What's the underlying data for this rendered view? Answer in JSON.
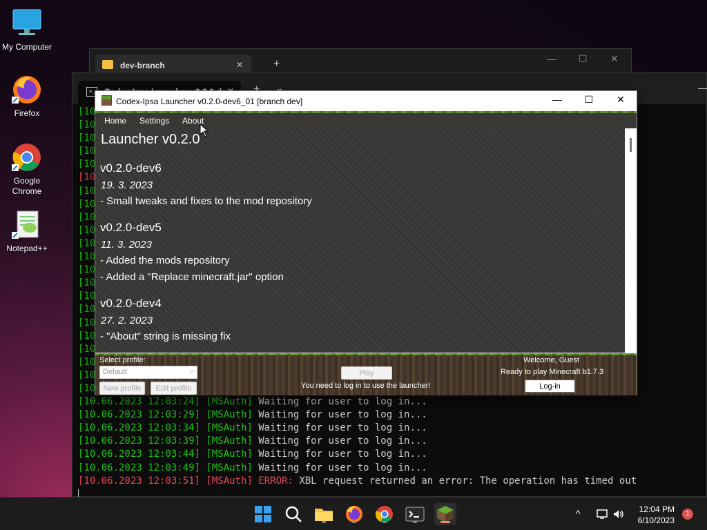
{
  "desktop": {
    "icons": [
      {
        "label1": "My Computer",
        "label2": ""
      },
      {
        "label1": "Firefox",
        "label2": ""
      },
      {
        "label1": "Google",
        "label2": "Chrome"
      },
      {
        "label1": "Notepad++",
        "label2": ""
      }
    ]
  },
  "explorer": {
    "tab_label": "dev-branch",
    "close": "✕",
    "new_tab": "+",
    "minimize": "—",
    "maximize": "☐",
    "close_window": "✕"
  },
  "terminal": {
    "tab_label": "Codex-Ipsa Launcher v0.2.0-d",
    "close": "✕",
    "new_tab": "+",
    "dropdown": "⌄",
    "minimize": "—",
    "hidden_prefixes": [
      "[10",
      "[10",
      "[10",
      "[10",
      "[10",
      "[10",
      "[10",
      "[10",
      "[10",
      "[10",
      "[10",
      "[10",
      "[10",
      "[10",
      "[10",
      "[10",
      "[10",
      "[10",
      "[10",
      "[10",
      "[10",
      "[10"
    ],
    "lines": [
      {
        "ts": "[10.06.2023 12:03:24]",
        "tag": " [MSAuth]",
        "msg": " Waiting for user to log in..."
      },
      {
        "ts": "[10.06.2023 12:03:29]",
        "tag": " [MSAuth]",
        "msg": " Waiting for user to log in..."
      },
      {
        "ts": "[10.06.2023 12:03:34]",
        "tag": " [MSAuth]",
        "msg": " Waiting for user to log in..."
      },
      {
        "ts": "[10.06.2023 12:03:39]",
        "tag": " [MSAuth]",
        "msg": " Waiting for user to log in..."
      },
      {
        "ts": "[10.06.2023 12:03:44]",
        "tag": " [MSAuth]",
        "msg": " Waiting for user to log in..."
      },
      {
        "ts": "[10.06.2023 12:03:49]",
        "tag": " [MSAuth]",
        "msg": " Waiting for user to log in..."
      }
    ],
    "error_line": {
      "ts": "[10.06.2023 12:03:51]",
      "tag": " [MSAuth]",
      "label": " ERROR:",
      "msg": " XBL request returned an error: The operation has timed out"
    }
  },
  "launcher": {
    "title": "Codex-Ipsa Launcher v0.2.0-dev6_01 [branch dev]",
    "controls": {
      "minimize": "—",
      "maximize": "☐",
      "close": "✕"
    },
    "menu": [
      "Home",
      "Settings",
      "About"
    ],
    "heading": "Launcher v0.2.0",
    "changelog": [
      {
        "version": "v0.2.0-dev6",
        "date": "19. 3. 2023",
        "items": [
          "- Small tweaks and fixes to the mod repository"
        ]
      },
      {
        "version": "v0.2.0-dev5",
        "date": "11. 3. 2023",
        "items": [
          "- Added the mods repository",
          "- Added a \"Replace minecraft.jar\" option"
        ]
      },
      {
        "version": "v0.2.0-dev4",
        "date": "27. 2. 2023",
        "items": [
          "- \"About\" string is missing fix"
        ]
      }
    ],
    "bottom": {
      "select_profile_label": "Select profile:",
      "profile_value": "Default",
      "new_profile": "New profile",
      "edit_profile": "Edit profile",
      "play": "Play",
      "login_notice": "You need to log in to use the launcher!",
      "welcome": "Welcome, Guest",
      "ready": "Ready to play Minecraft b1.7.3",
      "login_button": "Log-in"
    }
  },
  "taskbar": {
    "icons": [
      "start-icon",
      "search-icon",
      "file-explorer-icon",
      "firefox-icon",
      "chrome-icon",
      "terminal-icon",
      "minecraft-launcher-icon"
    ],
    "time": "12:04 PM",
    "date": "6/10/2023",
    "notifications": "1",
    "tray_chevron": "^"
  },
  "colors": {
    "terminal_green": "#16c60c",
    "terminal_red": "#e74856",
    "accent_red": "#d9534f"
  }
}
